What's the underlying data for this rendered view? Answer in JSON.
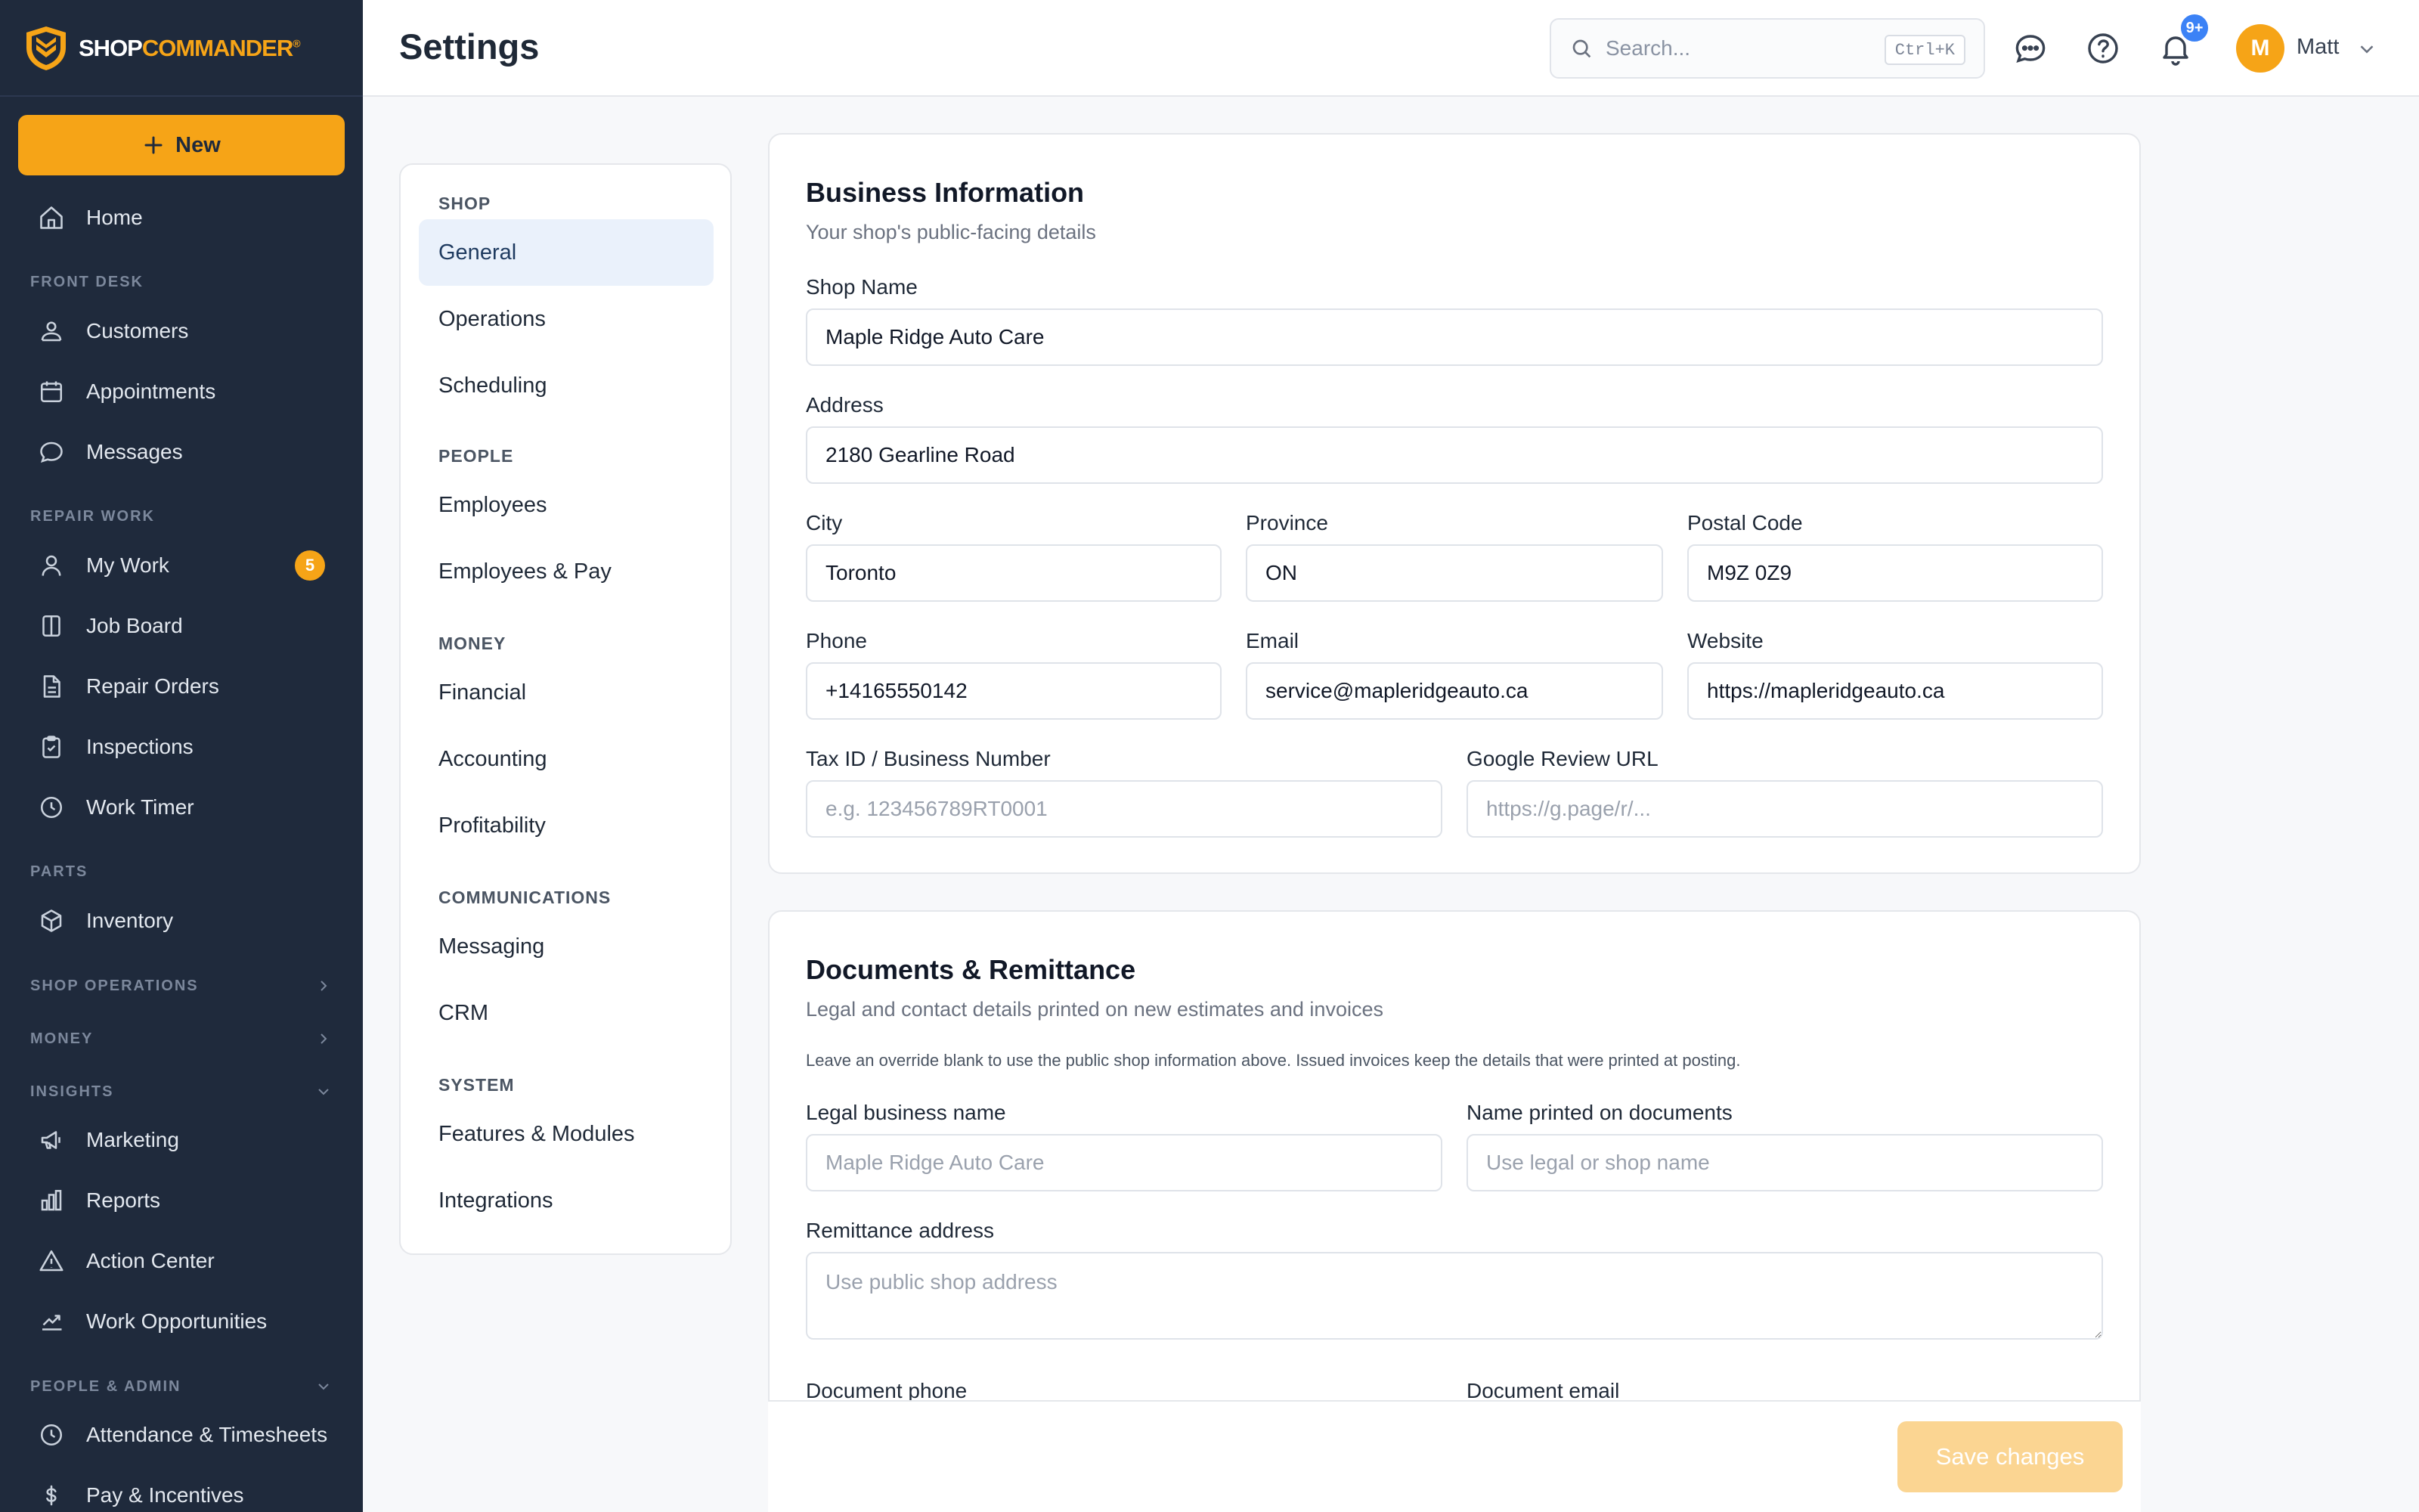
{
  "brand": {
    "name_part1": "SHOP",
    "name_part2": "COMMANDER",
    "mark": "®",
    "accent": "#f6a417"
  },
  "sidebar": {
    "new_label": "New",
    "home": "Home",
    "sections": {
      "front_desk": "FRONT DESK",
      "repair_work": "REPAIR WORK",
      "parts": "PARTS",
      "shop_operations": "SHOP OPERATIONS",
      "money": "MONEY",
      "insights": "INSIGHTS",
      "people_admin": "PEOPLE & ADMIN"
    },
    "items": {
      "customers": "Customers",
      "appointments": "Appointments",
      "messages": "Messages",
      "my_work": "My Work",
      "my_work_badge": "5",
      "job_board": "Job Board",
      "repair_orders": "Repair Orders",
      "inspections": "Inspections",
      "work_timer": "Work Timer",
      "inventory": "Inventory",
      "marketing": "Marketing",
      "reports": "Reports",
      "action_center": "Action Center",
      "work_opportunities": "Work Opportunities",
      "attendance": "Attendance & Timesheets",
      "pay": "Pay & Incentives"
    }
  },
  "header": {
    "title": "Settings",
    "search_placeholder": "Search...",
    "search_shortcut": "Ctrl+K",
    "notif_badge": "9+",
    "avatar_initial": "M",
    "user_name": "Matt"
  },
  "subnav": {
    "sections": {
      "shop": "SHOP",
      "people": "PEOPLE",
      "money": "MONEY",
      "communications": "COMMUNICATIONS",
      "system": "SYSTEM"
    },
    "items": {
      "general": "General",
      "operations": "Operations",
      "scheduling": "Scheduling",
      "employees": "Employees",
      "employees_pay": "Employees & Pay",
      "financial": "Financial",
      "accounting": "Accounting",
      "profitability": "Profitability",
      "messaging": "Messaging",
      "crm": "CRM",
      "features": "Features & Modules",
      "integrations": "Integrations"
    }
  },
  "business": {
    "title": "Business Information",
    "subtitle": "Your shop's public-facing details",
    "shop_name_label": "Shop Name",
    "shop_name": "Maple Ridge Auto Care",
    "address_label": "Address",
    "address": "2180 Gearline Road",
    "city_label": "City",
    "city": "Toronto",
    "province_label": "Province",
    "province": "ON",
    "postal_label": "Postal Code",
    "postal": "M9Z 0Z9",
    "phone_label": "Phone",
    "phone": "+14165550142",
    "email_label": "Email",
    "email": "service@mapleridgeauto.ca",
    "website_label": "Website",
    "website": "https://mapleridgeauto.ca",
    "tax_label": "Tax ID / Business Number",
    "tax_placeholder": "e.g. 123456789RT0001",
    "review_label": "Google Review URL",
    "review_placeholder": "https://g.page/r/..."
  },
  "documents": {
    "title": "Documents & Remittance",
    "subtitle": "Legal and contact details printed on new estimates and invoices",
    "note": "Leave an override blank to use the public shop information above. Issued invoices keep the details that were printed at posting.",
    "legal_label": "Legal business name",
    "legal_placeholder": "Maple Ridge Auto Care",
    "printed_label": "Name printed on documents",
    "printed_placeholder": "Use legal or shop name",
    "remit_label": "Remittance address",
    "remit_placeholder": "Use public shop address",
    "doc_phone_label": "Document phone",
    "doc_email_label": "Document email"
  },
  "footer": {
    "save_label": "Save changes"
  }
}
